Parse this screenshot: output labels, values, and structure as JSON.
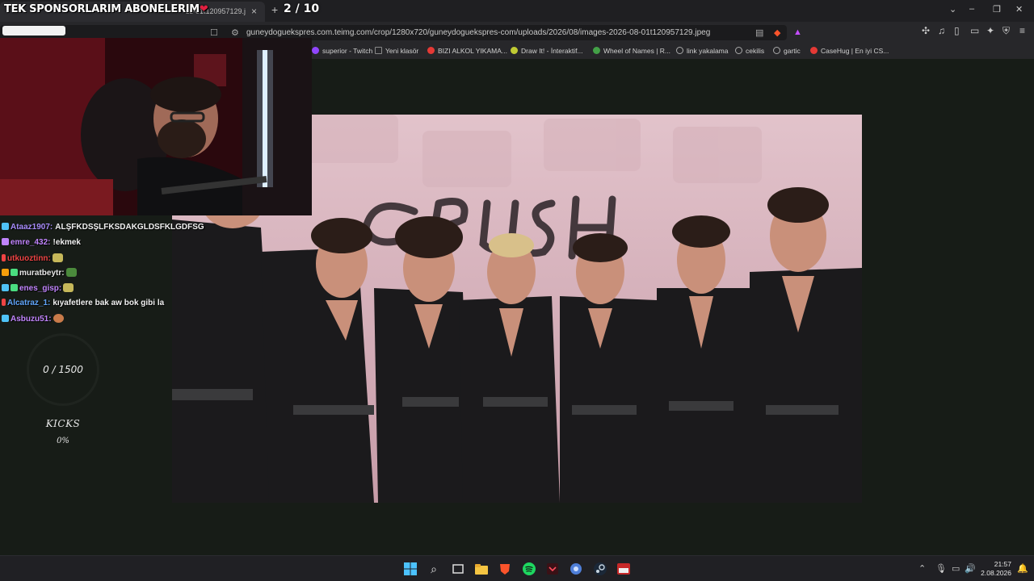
{
  "browser": {
    "tab_title": "ss-01t120957129.j",
    "tab_close": "×",
    "new_tab": "+",
    "url": "guneydoguekspres.com.teimg.com/crop/1280x720/guneydoguekspres-com/uploads/2026/08/images-2026-08-01t120957129.jpeg",
    "window_controls": [
      "⌄",
      "–",
      "❐",
      "✕"
    ]
  },
  "bookmarks": [
    {
      "label": "superior - Twitch",
      "color": "#9146ff"
    },
    {
      "label": "Yeni klasör",
      "color": "#888888"
    },
    {
      "label": "BIZI ALKOL YIKAMA...",
      "color": "#e53935"
    },
    {
      "label": "Draw It! - İnteraktif...",
      "color": "#c0ca33"
    },
    {
      "label": "Wheel of Names | R...",
      "color": "#43a047"
    },
    {
      "label": "link yakalama",
      "color": "#aaaaaa"
    },
    {
      "label": "cekilis",
      "color": "#aaaaaa"
    },
    {
      "label": "gartic",
      "color": "#aaaaaa"
    },
    {
      "label": "CaseHug | En iyi CS...",
      "color": "#e53935"
    }
  ],
  "overlay": {
    "title": "TEK SPONSORLARIM ABONELERIM",
    "heart": "❤",
    "counter": "2 / 10"
  },
  "chat": [
    {
      "user": "Ataaz1907:",
      "color": "#a78bfa",
      "message": "ALŞFKDSŞLFKSDAKGLDSFKLGDFSG",
      "badge": "#4fc3f7",
      "emote": ""
    },
    {
      "user": "emre_432:",
      "color": "#c084fc",
      "message": "!ekmek",
      "badge": "#c084fc",
      "emote": ""
    },
    {
      "user": "utkuoztinn:",
      "color": "#ef4444",
      "message": "",
      "badge": "#ef4444",
      "emote": "#c6b85a"
    },
    {
      "user": "muratbeytr:",
      "color": "#e6e6e6",
      "message": "",
      "badge": "#f59e0b",
      "emote": "#4b8a3c"
    },
    {
      "user": "enes_gisp:",
      "color": "#c084fc",
      "message": "",
      "badge": "#4fc3f7",
      "emote": "#c6b85a"
    },
    {
      "user": "Alcatraz_1:",
      "color": "#60a5fa",
      "message": "kıyafetlere bak aw bok gibi la",
      "badge": "#ef4444",
      "emote": ""
    },
    {
      "user": "Asbuzu51:",
      "color": "#c084fc",
      "message": "",
      "badge": "#4fc3f7",
      "emote": "#c97b4a"
    }
  ],
  "goal": {
    "text": "0 / 1500",
    "label": "KICKS",
    "percent": "0%",
    "progress": 0
  },
  "taskbar": {
    "time": "21:57",
    "date": "2.08.2026",
    "apps": [
      "windows-icon",
      "search-icon",
      "task-view-icon",
      "file-explorer-icon",
      "brave-icon",
      "spotify-icon",
      "editor-icon",
      "app-icon",
      "steam-icon",
      "obs-icon"
    ]
  }
}
